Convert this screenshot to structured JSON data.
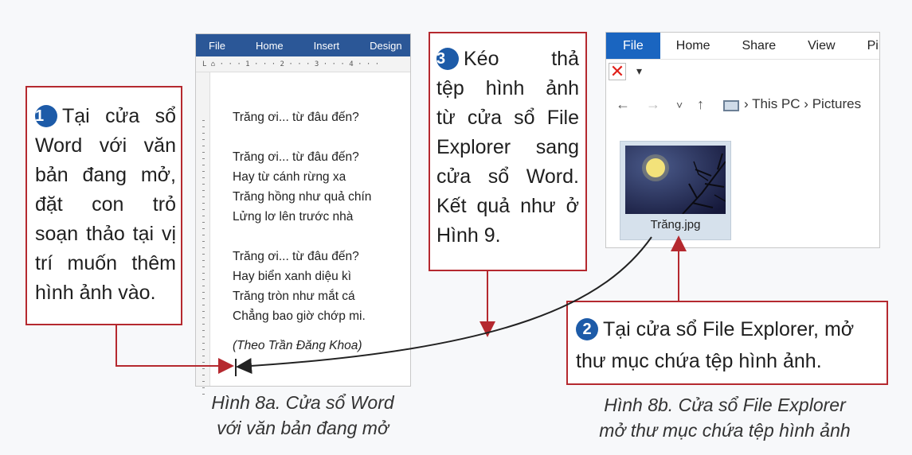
{
  "callouts": {
    "step1": {
      "number": "1",
      "lines": [
        "Tại cửa sổ",
        "Word với văn",
        "bản đang mở,",
        "đặt con trỏ",
        "soạn thảo tại vị",
        "trí muốn thêm",
        "hình ảnh vào."
      ]
    },
    "step2": {
      "number": "2",
      "lines": [
        "Tại cửa sổ File Explorer, mở",
        "thư mục chứa tệp hình ảnh."
      ]
    },
    "step3": {
      "number": "3",
      "lines": [
        "Kéo thả",
        "tệp hình ảnh",
        "từ cửa sổ File",
        "Explorer sang",
        "cửa sổ Word.",
        "Kết quả như ở",
        "Hình 9."
      ]
    }
  },
  "word": {
    "tabs": [
      "File",
      "Home",
      "Insert",
      "Design"
    ],
    "ruler": "L  ⌂ · · · 1 · · · 2 · · · 3 · · · 4 · · ·",
    "poem": {
      "title": "Trăng ơi... từ đâu đến?",
      "stanza1": [
        "Trăng ơi... từ đâu đến?",
        "Hay từ cánh rừng xa",
        "Trăng hồng như quả chín",
        "Lửng lơ lên trước nhà"
      ],
      "stanza2": [
        "Trăng ơi... từ đâu đến?",
        "Hay biển xanh diệu kì",
        "Trăng tròn như mắt cá",
        "Chẳng bao giờ chớp mi."
      ],
      "source": "(Theo Trần Đăng Khoa)"
    }
  },
  "explorer": {
    "tabs": [
      "File",
      "Home",
      "Share",
      "View",
      "Pi"
    ],
    "close_icon": "✕",
    "dropdown_icon": "▾",
    "nav": {
      "back": "←",
      "forward": "→",
      "recent": "˅",
      "up": "↑"
    },
    "path": [
      "This PC",
      "Pictures"
    ],
    "path_separator": "›",
    "file_name": "Trăng.jpg"
  },
  "captions": {
    "fig_a": [
      "Hình 8a. Cửa sổ Word",
      "với văn bản đang mở"
    ],
    "fig_b": [
      "Hình 8b. Cửa sổ File Explorer",
      "mở thư mục chứa tệp hình ảnh"
    ]
  },
  "colors": {
    "callout_border": "#b5292f",
    "step_number_bg": "#1d5ba8",
    "word_ribbon": "#2b5797",
    "explorer_file_tab": "#1a65c0",
    "arrow": "#b5292f"
  }
}
